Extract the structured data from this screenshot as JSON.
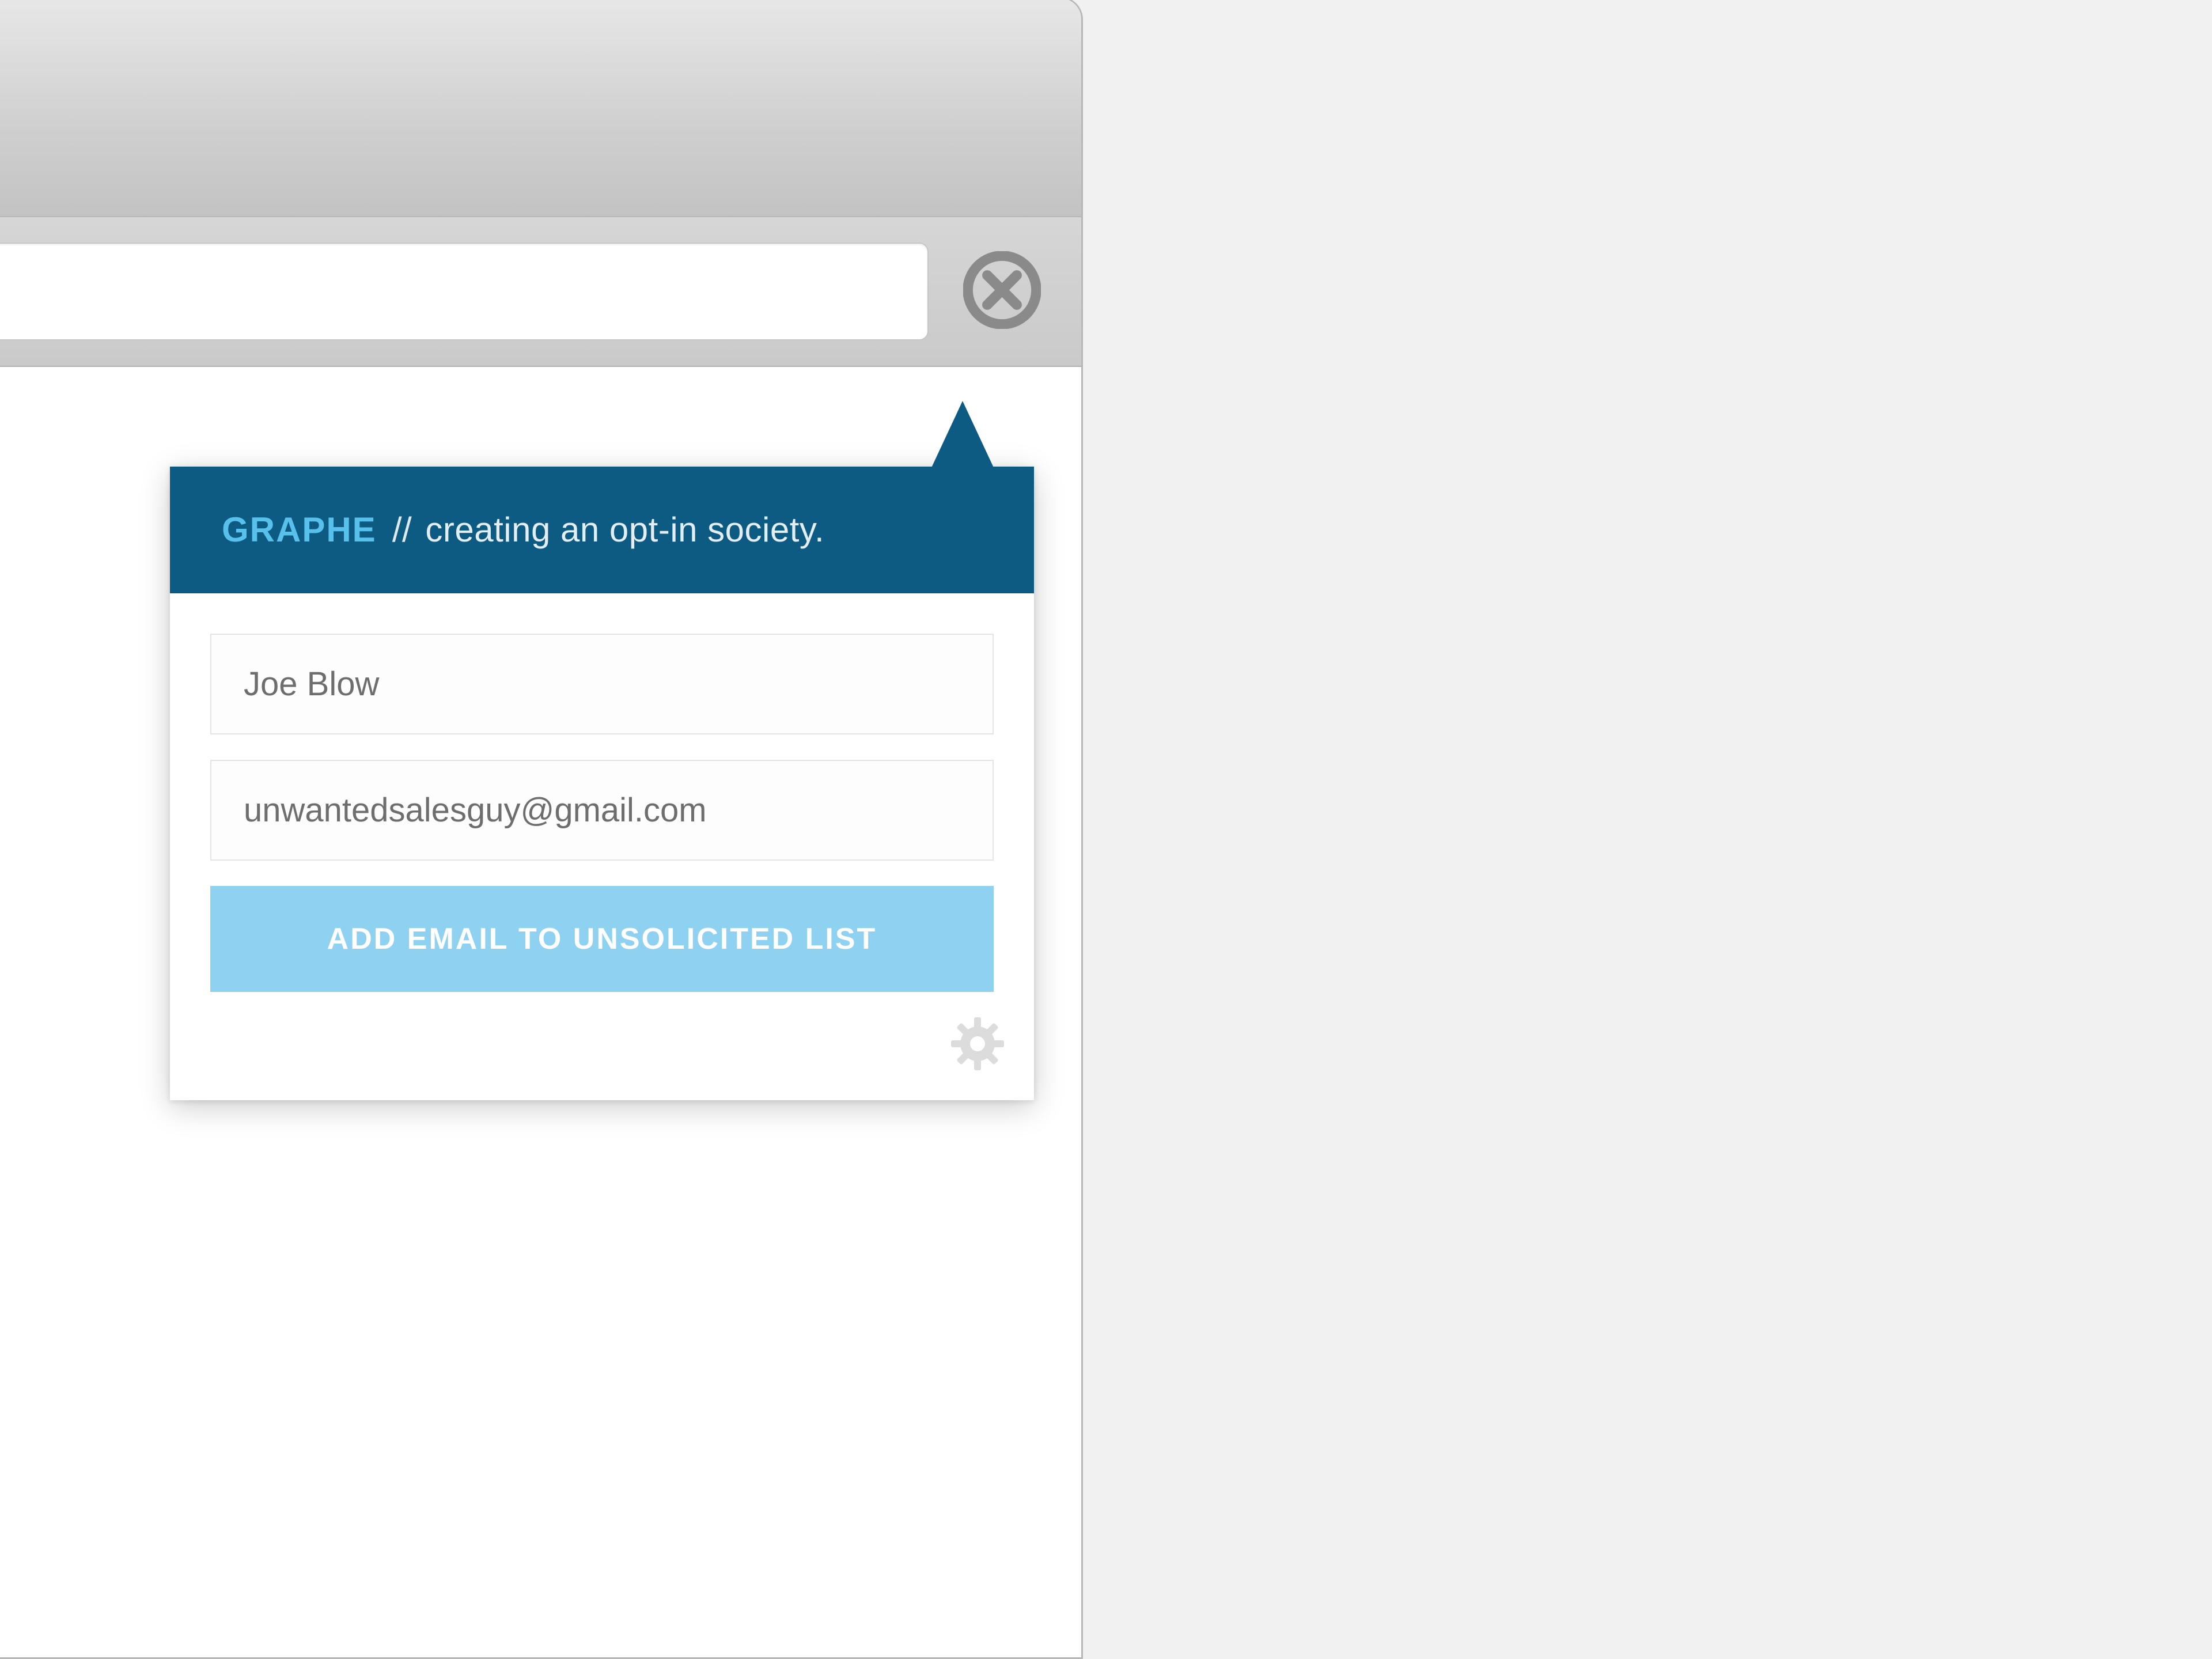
{
  "toolbar": {
    "address_value": "",
    "close_icon": "close-circle-icon"
  },
  "popover": {
    "brand": "GRAPHE",
    "separator": "//",
    "tagline": "creating an opt-in society.",
    "name_value": "Joe Blow",
    "email_value": "unwantedsalesguy@gmail.com",
    "submit_label": "ADD EMAIL TO UNSOLICITED LIST",
    "settings_icon": "gear-icon"
  },
  "colors": {
    "header_bg": "#0d5b82",
    "brand_text": "#57c1ec",
    "button_bg": "#8ed1f0",
    "page_bg": "#f1f1f1"
  }
}
